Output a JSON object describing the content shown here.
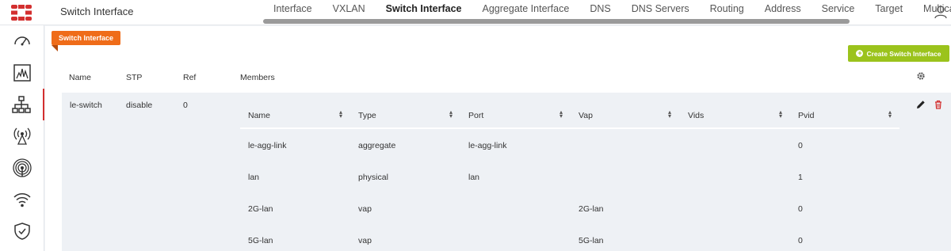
{
  "header": {
    "page_title": "Switch Interface",
    "tabs": [
      {
        "label": "Interface"
      },
      {
        "label": "VXLAN"
      },
      {
        "label": "Switch Interface",
        "active": true
      },
      {
        "label": "Aggregate Interface"
      },
      {
        "label": "DNS"
      },
      {
        "label": "DNS Servers"
      },
      {
        "label": "Routing"
      },
      {
        "label": "Address"
      },
      {
        "label": "Service"
      },
      {
        "label": "Target"
      },
      {
        "label": "Multicast"
      }
    ]
  },
  "sidebar": {
    "items": [
      {
        "icon": "dashboard-gauge-icon"
      },
      {
        "icon": "monitor-chart-icon"
      },
      {
        "icon": "network-tree-icon",
        "active": true
      },
      {
        "icon": "wireless-tower-icon"
      },
      {
        "icon": "broadcast-icon"
      },
      {
        "icon": "wifi-icon"
      },
      {
        "icon": "security-shield-icon"
      }
    ]
  },
  "section_badge": "Switch Interface",
  "create_button": {
    "label": "Create Switch Interface"
  },
  "table": {
    "columns": [
      "Name",
      "STP",
      "Ref",
      "Members"
    ],
    "rows": [
      {
        "name": "le-switch",
        "stp": "disable",
        "ref": "0",
        "members": {
          "columns": [
            "Name",
            "Type",
            "Port",
            "Vap",
            "Vids",
            "Pvid"
          ],
          "rows": [
            {
              "name": "le-agg-link",
              "type": "aggregate",
              "port": "le-agg-link",
              "vap": "",
              "vids": "",
              "pvid": "0"
            },
            {
              "name": "lan",
              "type": "physical",
              "port": "lan",
              "vap": "",
              "vids": "",
              "pvid": "1"
            },
            {
              "name": "2G-lan",
              "type": "vap",
              "port": "",
              "vap": "2G-lan",
              "vids": "",
              "pvid": "0"
            },
            {
              "name": "5G-lan",
              "type": "vap",
              "port": "",
              "vap": "5G-lan",
              "vids": "",
              "pvid": "0"
            }
          ]
        }
      }
    ]
  },
  "colors": {
    "accent": "#d32f2f",
    "badge": "#ef6c19",
    "create": "#9bc31c"
  }
}
